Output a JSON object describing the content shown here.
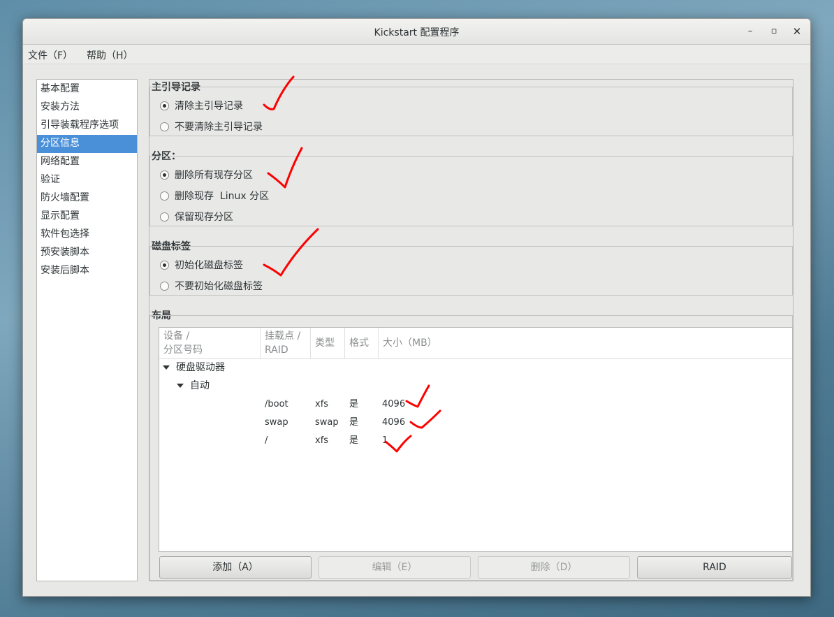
{
  "window": {
    "title": "Kickstart 配置程序",
    "minimize_glyph": "–",
    "maximize_glyph": "▫",
    "close_glyph": "✕"
  },
  "menubar": {
    "file": "文件（F）",
    "help": "帮助（H）"
  },
  "sidebar": {
    "selected_index": 3,
    "items": [
      "基本配置",
      "安装方法",
      "引导装载程序选项",
      "分区信息",
      "网络配置",
      "验证",
      "防火墙配置",
      "显示配置",
      "软件包选择",
      "预安装脚本",
      "安装后脚本"
    ]
  },
  "mbr": {
    "label": "主引导记录",
    "options": [
      "清除主引导记录",
      "不要清除主引导记录"
    ],
    "selected": 0
  },
  "partitions": {
    "label": "分区：",
    "options": [
      "删除所有现存分区",
      "删除现存  Linux 分区",
      "保留现存分区"
    ],
    "selected": 0
  },
  "disklabel": {
    "label": "磁盘标签",
    "options": [
      "初始化磁盘标签",
      "不要初始化磁盘标签"
    ],
    "selected": 0
  },
  "layout": {
    "label": "布局",
    "columns": {
      "device_l1": "设备 /",
      "device_l2": "分区号码",
      "mount_l1": "挂载点 /",
      "mount_l2": "RAID",
      "type": "类型",
      "format": "格式",
      "size": "大小（MB）"
    },
    "tree": {
      "root": "硬盘驱动器",
      "child": "自动"
    },
    "rows": [
      {
        "mount": "/boot",
        "type": "xfs",
        "format": "是",
        "size": "4096"
      },
      {
        "mount": "swap",
        "type": "swap",
        "format": "是",
        "size": "4096"
      },
      {
        "mount": "/",
        "type": "xfs",
        "format": "是",
        "size": "1"
      }
    ]
  },
  "buttons": {
    "add": "添加（A）",
    "edit": "编辑（E）",
    "delete": "删除（D）",
    "raid": "RAID"
  },
  "annotation_color": "#ff0000"
}
